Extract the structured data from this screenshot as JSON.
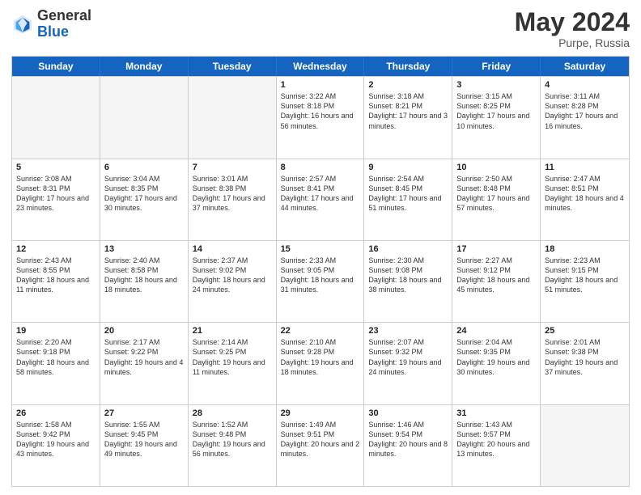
{
  "header": {
    "logo_general": "General",
    "logo_blue": "Blue",
    "month_title": "May 2024",
    "location": "Purpe, Russia"
  },
  "days_of_week": [
    "Sunday",
    "Monday",
    "Tuesday",
    "Wednesday",
    "Thursday",
    "Friday",
    "Saturday"
  ],
  "rows": [
    [
      {
        "day": "",
        "empty": true
      },
      {
        "day": "",
        "empty": true
      },
      {
        "day": "",
        "empty": true
      },
      {
        "day": "1",
        "sunrise": "3:22 AM",
        "sunset": "8:18 PM",
        "daylight": "16 hours and 56 minutes."
      },
      {
        "day": "2",
        "sunrise": "3:18 AM",
        "sunset": "8:21 PM",
        "daylight": "17 hours and 3 minutes."
      },
      {
        "day": "3",
        "sunrise": "3:15 AM",
        "sunset": "8:25 PM",
        "daylight": "17 hours and 10 minutes."
      },
      {
        "day": "4",
        "sunrise": "3:11 AM",
        "sunset": "8:28 PM",
        "daylight": "17 hours and 16 minutes."
      }
    ],
    [
      {
        "day": "5",
        "sunrise": "3:08 AM",
        "sunset": "8:31 PM",
        "daylight": "17 hours and 23 minutes."
      },
      {
        "day": "6",
        "sunrise": "3:04 AM",
        "sunset": "8:35 PM",
        "daylight": "17 hours and 30 minutes."
      },
      {
        "day": "7",
        "sunrise": "3:01 AM",
        "sunset": "8:38 PM",
        "daylight": "17 hours and 37 minutes."
      },
      {
        "day": "8",
        "sunrise": "2:57 AM",
        "sunset": "8:41 PM",
        "daylight": "17 hours and 44 minutes."
      },
      {
        "day": "9",
        "sunrise": "2:54 AM",
        "sunset": "8:45 PM",
        "daylight": "17 hours and 51 minutes."
      },
      {
        "day": "10",
        "sunrise": "2:50 AM",
        "sunset": "8:48 PM",
        "daylight": "17 hours and 57 minutes."
      },
      {
        "day": "11",
        "sunrise": "2:47 AM",
        "sunset": "8:51 PM",
        "daylight": "18 hours and 4 minutes."
      }
    ],
    [
      {
        "day": "12",
        "sunrise": "2:43 AM",
        "sunset": "8:55 PM",
        "daylight": "18 hours and 11 minutes."
      },
      {
        "day": "13",
        "sunrise": "2:40 AM",
        "sunset": "8:58 PM",
        "daylight": "18 hours and 18 minutes."
      },
      {
        "day": "14",
        "sunrise": "2:37 AM",
        "sunset": "9:02 PM",
        "daylight": "18 hours and 24 minutes."
      },
      {
        "day": "15",
        "sunrise": "2:33 AM",
        "sunset": "9:05 PM",
        "daylight": "18 hours and 31 minutes."
      },
      {
        "day": "16",
        "sunrise": "2:30 AM",
        "sunset": "9:08 PM",
        "daylight": "18 hours and 38 minutes."
      },
      {
        "day": "17",
        "sunrise": "2:27 AM",
        "sunset": "9:12 PM",
        "daylight": "18 hours and 45 minutes."
      },
      {
        "day": "18",
        "sunrise": "2:23 AM",
        "sunset": "9:15 PM",
        "daylight": "18 hours and 51 minutes."
      }
    ],
    [
      {
        "day": "19",
        "sunrise": "2:20 AM",
        "sunset": "9:18 PM",
        "daylight": "18 hours and 58 minutes."
      },
      {
        "day": "20",
        "sunrise": "2:17 AM",
        "sunset": "9:22 PM",
        "daylight": "19 hours and 4 minutes."
      },
      {
        "day": "21",
        "sunrise": "2:14 AM",
        "sunset": "9:25 PM",
        "daylight": "19 hours and 11 minutes."
      },
      {
        "day": "22",
        "sunrise": "2:10 AM",
        "sunset": "9:28 PM",
        "daylight": "19 hours and 18 minutes."
      },
      {
        "day": "23",
        "sunrise": "2:07 AM",
        "sunset": "9:32 PM",
        "daylight": "19 hours and 24 minutes."
      },
      {
        "day": "24",
        "sunrise": "2:04 AM",
        "sunset": "9:35 PM",
        "daylight": "19 hours and 30 minutes."
      },
      {
        "day": "25",
        "sunrise": "2:01 AM",
        "sunset": "9:38 PM",
        "daylight": "19 hours and 37 minutes."
      }
    ],
    [
      {
        "day": "26",
        "sunrise": "1:58 AM",
        "sunset": "9:42 PM",
        "daylight": "19 hours and 43 minutes."
      },
      {
        "day": "27",
        "sunrise": "1:55 AM",
        "sunset": "9:45 PM",
        "daylight": "19 hours and 49 minutes."
      },
      {
        "day": "28",
        "sunrise": "1:52 AM",
        "sunset": "9:48 PM",
        "daylight": "19 hours and 56 minutes."
      },
      {
        "day": "29",
        "sunrise": "1:49 AM",
        "sunset": "9:51 PM",
        "daylight": "20 hours and 2 minutes."
      },
      {
        "day": "30",
        "sunrise": "1:46 AM",
        "sunset": "9:54 PM",
        "daylight": "20 hours and 8 minutes."
      },
      {
        "day": "31",
        "sunrise": "1:43 AM",
        "sunset": "9:57 PM",
        "daylight": "20 hours and 13 minutes."
      },
      {
        "day": "",
        "empty": true
      }
    ]
  ]
}
